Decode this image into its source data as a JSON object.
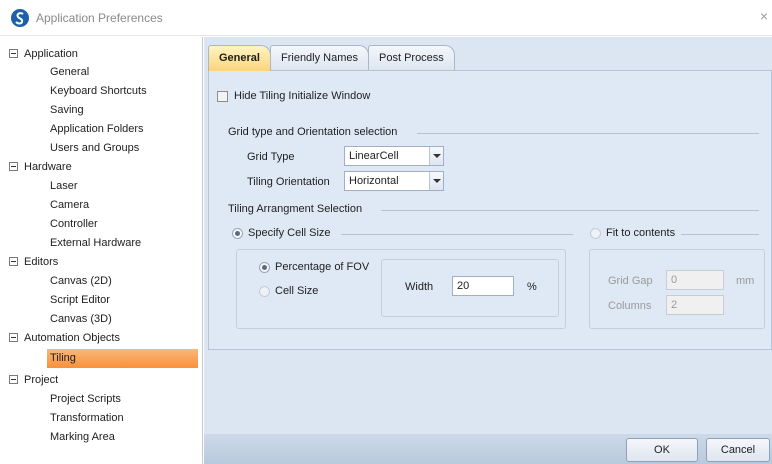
{
  "window": {
    "title": "Application Preferences",
    "close_glyph": "×"
  },
  "tree": [
    {
      "label": "Application",
      "children": [
        "General",
        "Keyboard Shortcuts",
        "Saving",
        "Application Folders",
        "Users and Groups"
      ]
    },
    {
      "label": "Hardware",
      "children": [
        "Laser",
        "Camera",
        "Controller",
        "External Hardware"
      ]
    },
    {
      "label": "Editors",
      "children": [
        "Canvas (2D)",
        "Script Editor",
        "Canvas (3D)"
      ]
    },
    {
      "label": "Automation Objects",
      "children": [
        "Tiling"
      ]
    },
    {
      "label": "Project",
      "children": [
        "Project Scripts",
        "Transformation",
        "Marking Area"
      ]
    }
  ],
  "tree_selected": "Tiling",
  "tabs": [
    {
      "label": "General",
      "active": true
    },
    {
      "label": "Friendly Names",
      "active": false
    },
    {
      "label": "Post Process",
      "active": false
    }
  ],
  "general": {
    "hide_tiling_label": "Hide Tiling Initialize Window",
    "hide_tiling_checked": false,
    "grid_group_title": "Grid type and Orientation selection",
    "grid_type_label": "Grid Type",
    "grid_type_value": "LinearCell",
    "orientation_label": "Tiling Orientation",
    "orientation_value": "Horizontal",
    "arrangement_group_title": "Tiling Arrangment Selection",
    "specify_cell_label": "Specify Cell Size",
    "fit_label": "Fit to contents",
    "percentage_label": "Percentage of FOV",
    "cell_size_label": "Cell Size",
    "width_label": "Width",
    "width_value": "20",
    "width_unit": "%",
    "grid_gap_label": "Grid Gap",
    "grid_gap_value": "0",
    "grid_gap_unit": "mm",
    "columns_label": "Columns",
    "columns_value": "2"
  },
  "buttons": {
    "ok": "OK",
    "cancel": "Cancel"
  },
  "colors": {
    "selection": "#f7913b",
    "pane_bg": "#dce6f2",
    "active_tab": "#fbd57a"
  }
}
